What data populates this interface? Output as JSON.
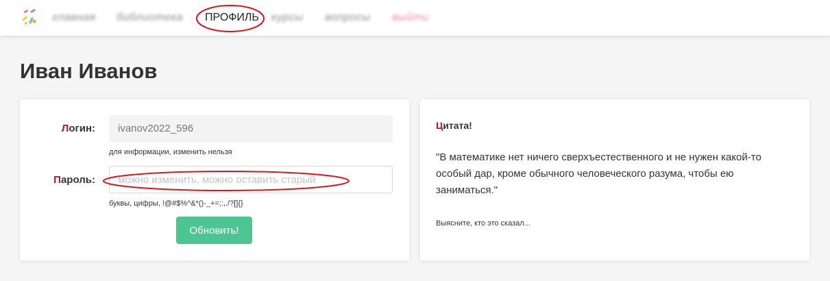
{
  "nav": {
    "logo_icon": "pencils-logo-icon",
    "items": [
      {
        "label": "главная",
        "blurred": true
      },
      {
        "label": "библиотека",
        "blurred": true
      },
      {
        "label": "ПРОФИЛЬ",
        "active": true
      },
      {
        "label": "курсы",
        "blurred": true
      },
      {
        "label": "вопросы",
        "blurred": true
      },
      {
        "label": "выйти",
        "blurred": true
      }
    ]
  },
  "page": {
    "title": "Иван Иванов"
  },
  "form": {
    "login_label_first": "Л",
    "login_label_rest": "огин:",
    "login_value": "ivanov2022_596",
    "login_hint": "для информации, изменить нельзя",
    "password_label_first": "П",
    "password_label_rest": "ароль:",
    "password_placeholder": "можно изменить, можно оставить старый",
    "password_hint": "буквы, цифры, !@#$%^&*()-_+=;:,./?[]{}",
    "submit_label": "Обновить!"
  },
  "quote": {
    "title_first": "Ц",
    "title_rest": "итата!",
    "text": "\"В математике нет ничего сверхъестественного и не нужен какой-то особый дар, кроме обычного человеческого разума, чтобы ею заниматься.\"",
    "hint": "Выясните, кто это сказал..."
  },
  "colors": {
    "accent": "#b3123b",
    "button": "#4cc593",
    "annotation": "#d9141b"
  }
}
